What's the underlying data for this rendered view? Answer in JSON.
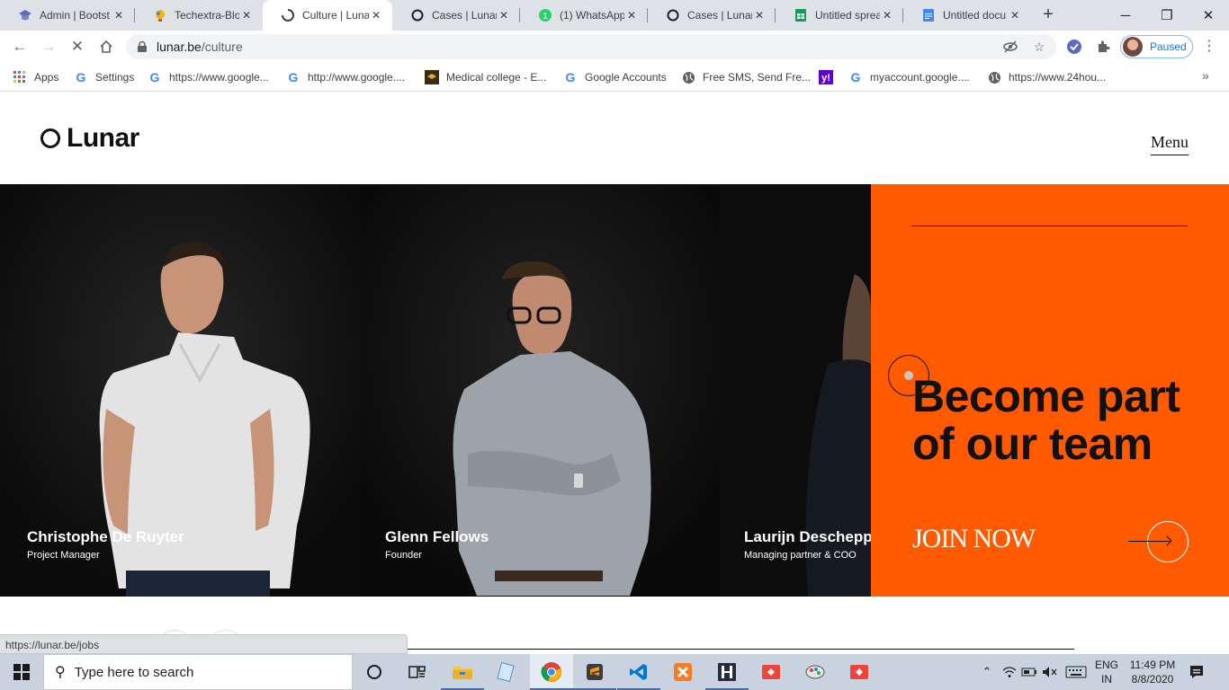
{
  "browser": {
    "tabs": [
      {
        "title": "Admin | Bootst",
        "icon": "graduation-cap-icon"
      },
      {
        "title": "Techextra-Blog",
        "icon": "lightbulb-icon"
      },
      {
        "title": "Culture | Lunar",
        "icon": "lunar-loading-icon",
        "active": true
      },
      {
        "title": "Cases | Lunar",
        "icon": "lunar-icon"
      },
      {
        "title": "(1) WhatsApp",
        "icon": "whatsapp-icon"
      },
      {
        "title": "Cases | Lunar",
        "icon": "lunar-icon"
      },
      {
        "title": "Untitled sprea",
        "icon": "google-sheets-icon"
      },
      {
        "title": "Untitled docu",
        "icon": "google-docs-icon"
      }
    ],
    "address_host": "lunar.be",
    "address_path": "/culture",
    "profile_status": "Paused",
    "bookmarks": [
      {
        "label": "Apps",
        "icon": "apps-grid-icon"
      },
      {
        "label": "Settings",
        "icon": "google-icon"
      },
      {
        "label": "https://www.google...",
        "icon": "google-icon"
      },
      {
        "label": "http://www.google....",
        "icon": "google-icon"
      },
      {
        "label": "Medical college - E...",
        "icon": "college-icon"
      },
      {
        "label": "Google Accounts",
        "icon": "google-icon"
      },
      {
        "label": "Free SMS, Send Fre...",
        "icon": "globe-icon"
      },
      {
        "label": "",
        "icon": "yahoo-icon"
      },
      {
        "label": "myaccount.google....",
        "icon": "google-icon"
      },
      {
        "label": "https://www.24hou...",
        "icon": "globe-icon"
      }
    ],
    "status_url": "https://lunar.be/jobs"
  },
  "site": {
    "logo_text": "Lunar",
    "menu_label": "Menu",
    "people": [
      {
        "name": "Christophe De Ruyter",
        "role": "Project Manager"
      },
      {
        "name": "Glenn Fellows",
        "role": "Founder"
      },
      {
        "name": "Laurijn Deschepp",
        "role": "Managing partner & COO"
      }
    ],
    "cta_heading": "Become part of our team",
    "cta_link": "JOIN NOW",
    "accent_color": "#ff5a00"
  },
  "taskbar": {
    "search_placeholder": "Type here to search",
    "language_top": "ENG",
    "language_bottom": "IN",
    "time": "11:49 PM",
    "date": "8/8/2020"
  }
}
